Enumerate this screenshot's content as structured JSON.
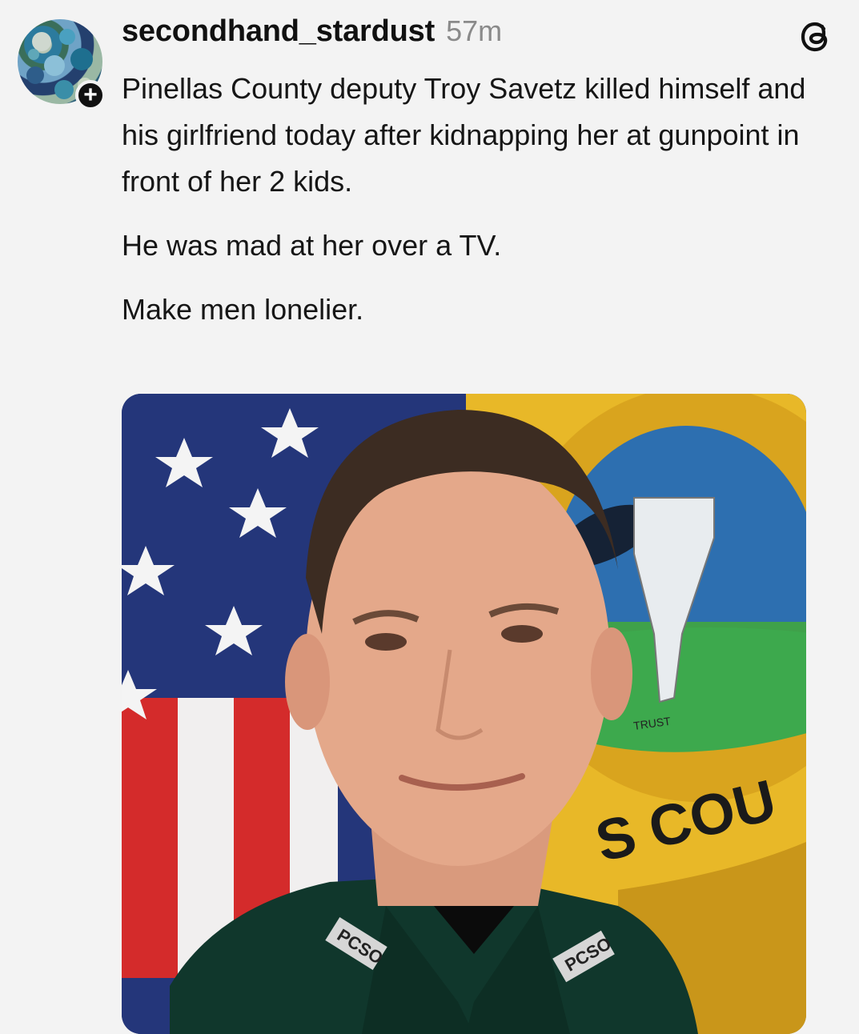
{
  "post": {
    "username": "secondhand_stardust",
    "timestamp": "57m",
    "follow_icon": "plus-icon",
    "app_icon": "threads-logo-icon",
    "paragraphs": [
      "Pinellas County deputy Troy Savetz killed himself and his girlfriend today after kidnapping her at gunpoint in front of her 2 kids.",
      "He was mad at her over a TV.",
      "Make men lonelier."
    ],
    "image": {
      "seal_text": "S COU",
      "seal_small_text": "TRUST",
      "collar_badge_text": "PCSO"
    }
  },
  "colors": {
    "background": "#f3f3f3",
    "text": "#161616",
    "muted": "#8a8a8a"
  }
}
